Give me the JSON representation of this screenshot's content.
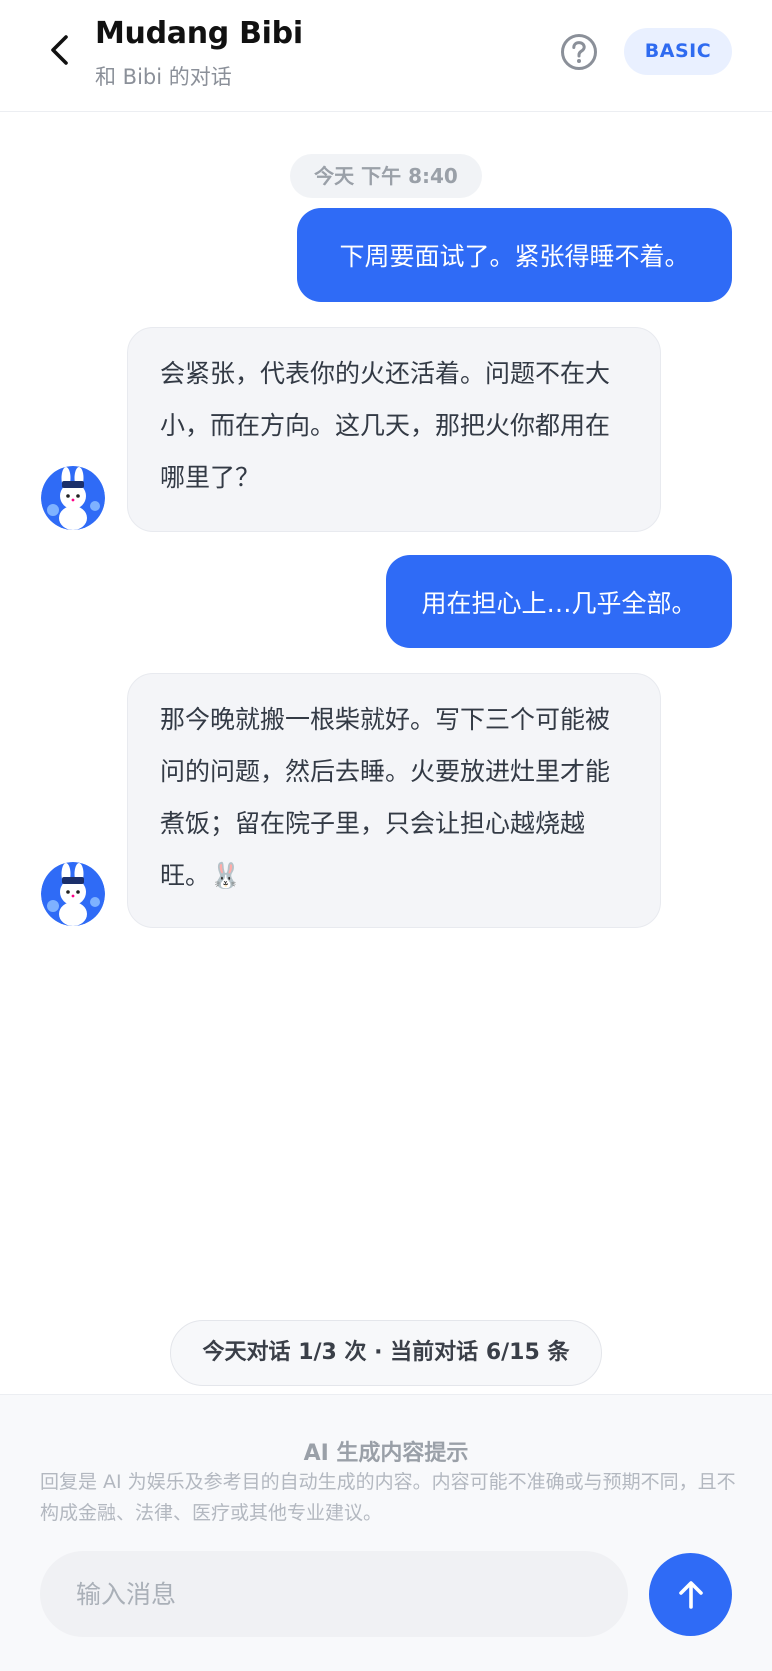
{
  "header": {
    "title": "Mudang Bibi",
    "subtitle": "和 Bibi 的对话",
    "plan_badge": "BASIC",
    "icons": {
      "back": "chevron-left-icon",
      "help": "question-circle-icon"
    }
  },
  "chat": {
    "timestamp": "今天 下午 8:40",
    "messages": [
      {
        "role": "user",
        "text": "下周要面试了。紧张得睡不着。"
      },
      {
        "role": "assistant",
        "text": "会紧张，代表你的火还活着。问题不在大小，而在方向。这几天，那把火你都用在哪里了？"
      },
      {
        "role": "user",
        "text": "用在担心上…几乎全部。"
      },
      {
        "role": "assistant",
        "text": "那今晚就搬一根柴就好。写下三个可能被问的问题，然后去睡。火要放进灶里才能煮饭；留在院子里，只会让担心越烧越旺。🐰"
      }
    ]
  },
  "quota": {
    "text": "今天对话 1/3 次 · 当前对话 6/15 条"
  },
  "notice": {
    "title": "AI 生成内容提示",
    "text": "回复是 AI 为娱乐及参考目的自动生成的内容。内容可能不准确或与预期不同，且不构成金融、法律、医疗或其他专业建议。"
  },
  "composer": {
    "placeholder": "输入消息",
    "send_icon": "arrow-up-icon"
  },
  "colors": {
    "accent": "#2f6bf6",
    "user_bubble": "#2f6bf6",
    "assistant_bubble": "#f4f5f8",
    "badge_bg": "#e9f0ff"
  }
}
